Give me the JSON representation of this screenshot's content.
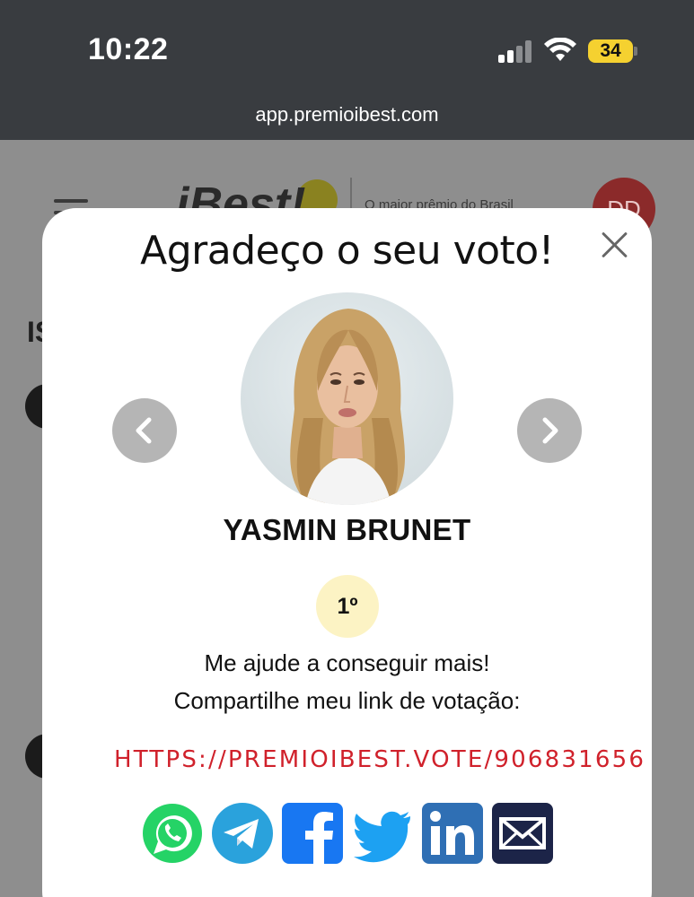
{
  "status_bar": {
    "time": "10:22",
    "battery": "34"
  },
  "browser": {
    "url": "app.premioibest.com"
  },
  "background_page": {
    "logo": "iBest!",
    "tagline": "O maior prêmio do Brasil",
    "user_initials": "DD",
    "partial_text": "IS"
  },
  "modal": {
    "title": "Agradeço o seu voto!",
    "nominee_name": "YASMIN BRUNET",
    "rank": "1º",
    "help_text": "Me ajude a conseguir mais!",
    "share_text": "Compartilhe meu link de votação:",
    "vote_link": "HTTPS://PREMIOIBEST.VOTE/906831656",
    "share_buttons": [
      {
        "name": "whatsapp",
        "color": "#25d366"
      },
      {
        "name": "telegram",
        "color": "#2aa2dc"
      },
      {
        "name": "facebook",
        "color": "#1877f2"
      },
      {
        "name": "twitter",
        "color": "#1da1f2"
      },
      {
        "name": "linkedin",
        "color": "#2f6fb4"
      },
      {
        "name": "email",
        "color": "#1c2448"
      }
    ]
  },
  "colors": {
    "status_bg": "#393c40",
    "battery": "#f5d130",
    "link": "#d0212b",
    "rank_bg": "#fcf3c4",
    "arrow_bg": "#b5b5b5"
  }
}
